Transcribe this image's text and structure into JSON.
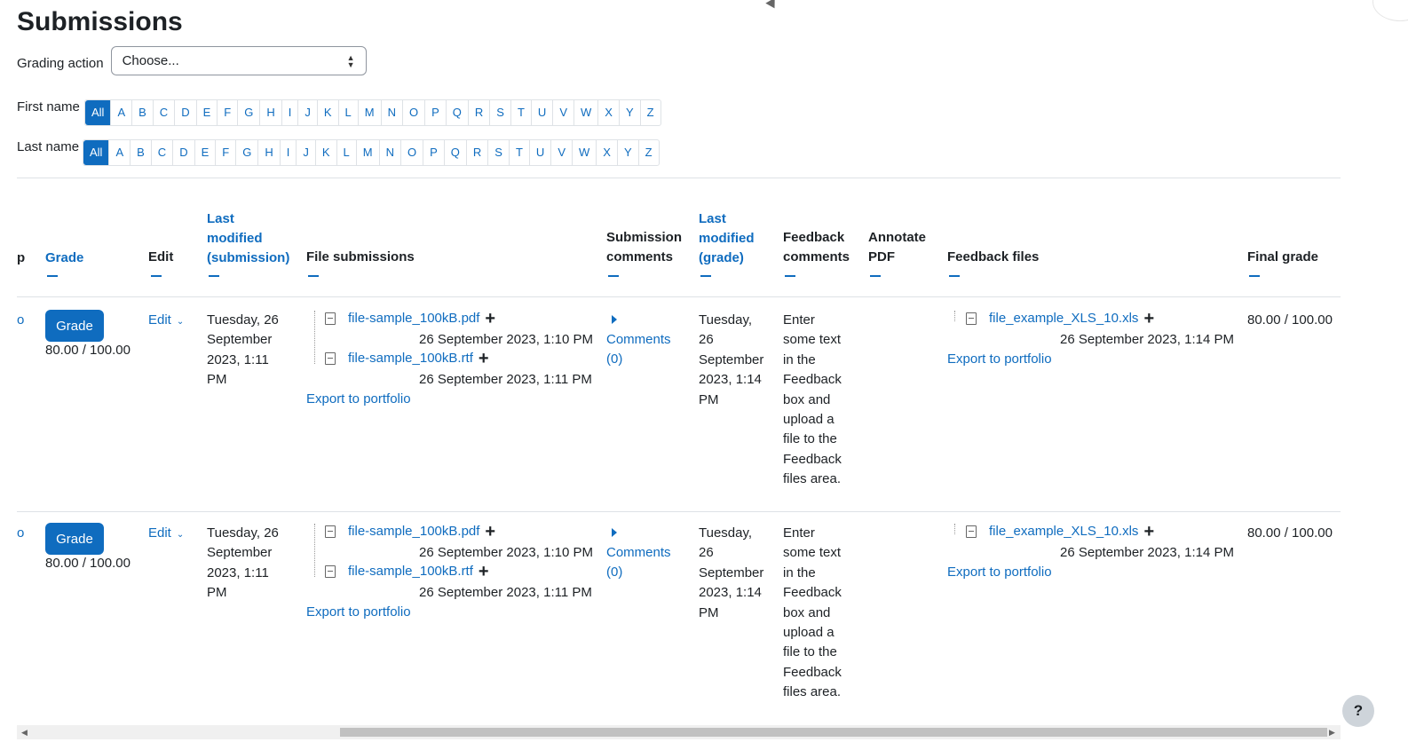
{
  "page_title": "Submissions",
  "grading_action": {
    "label": "Grading action",
    "value": "Choose..."
  },
  "first_name": {
    "label": "First name",
    "letters": [
      "All",
      "A",
      "B",
      "C",
      "D",
      "E",
      "F",
      "G",
      "H",
      "I",
      "J",
      "K",
      "L",
      "M",
      "N",
      "O",
      "P",
      "Q",
      "R",
      "S",
      "T",
      "U",
      "V",
      "W",
      "X",
      "Y",
      "Z"
    ]
  },
  "last_name": {
    "label": "Last name",
    "letters": [
      "All",
      "A",
      "B",
      "C",
      "D",
      "E",
      "F",
      "G",
      "H",
      "I",
      "J",
      "K",
      "L",
      "M",
      "N",
      "O",
      "P",
      "Q",
      "R",
      "S",
      "T",
      "U",
      "V",
      "W",
      "X",
      "Y",
      "Z"
    ]
  },
  "columns": {
    "partial": "p",
    "grade": "Grade",
    "edit": "Edit",
    "last_modified_submission": [
      "Last",
      "modified",
      "(submission)"
    ],
    "file_submissions": "File submissions",
    "submission_comments": [
      "Submission",
      "comments"
    ],
    "last_modified_grade": [
      "Last",
      "modified",
      "(grade)"
    ],
    "feedback_comments": [
      "Feedback",
      "comments"
    ],
    "annotate_pdf": [
      "Annotate",
      "PDF"
    ],
    "feedback_files": "Feedback files",
    "final_grade": "Final grade"
  },
  "rows": [
    {
      "partial": "o",
      "grade_button": "Grade",
      "grade_value": "80.00 / 100.00",
      "edit": "Edit",
      "last_modified_submission": [
        "Tuesday, 26",
        "September",
        "2023, 1:11",
        "PM"
      ],
      "files": [
        {
          "name": "file-sample_100kB.pdf",
          "date": "26 September 2023, 1:10 PM"
        },
        {
          "name": "file-sample_100kB.rtf",
          "date": "26 September 2023, 1:11 PM"
        }
      ],
      "export": "Export to portfolio",
      "comments": [
        "Comments",
        "(0)"
      ],
      "last_modified_grade": [
        "Tuesday,",
        "26",
        "September",
        "2023, 1:14",
        "PM"
      ],
      "feedback_comments": [
        "Enter",
        "some text",
        "in the",
        "Feedback",
        "box and",
        "upload a",
        "file to the",
        "Feedback",
        "files area."
      ],
      "feedback_file": {
        "name": "file_example_XLS_10.xls",
        "date": "26 September 2023, 1:14 PM"
      },
      "feedback_export": "Export to portfolio",
      "final_grade": "80.00 / 100.00"
    },
    {
      "partial": "o",
      "grade_button": "Grade",
      "grade_value": "80.00 / 100.00",
      "edit": "Edit",
      "last_modified_submission": [
        "Tuesday, 26",
        "September",
        "2023, 1:11",
        "PM"
      ],
      "files": [
        {
          "name": "file-sample_100kB.pdf",
          "date": "26 September 2023, 1:10 PM"
        },
        {
          "name": "file-sample_100kB.rtf",
          "date": "26 September 2023, 1:11 PM"
        }
      ],
      "export": "Export to portfolio",
      "comments": [
        "Comments",
        "(0)"
      ],
      "last_modified_grade": [
        "Tuesday,",
        "26",
        "September",
        "2023, 1:14",
        "PM"
      ],
      "feedback_comments": [
        "Enter",
        "some text",
        "in the",
        "Feedback",
        "box and",
        "upload a",
        "file to the",
        "Feedback",
        "files area."
      ],
      "feedback_file": {
        "name": "file_example_XLS_10.xls",
        "date": "26 September 2023, 1:14 PM"
      },
      "feedback_export": "Export to portfolio",
      "final_grade": "80.00 / 100.00"
    }
  ],
  "help": "?"
}
